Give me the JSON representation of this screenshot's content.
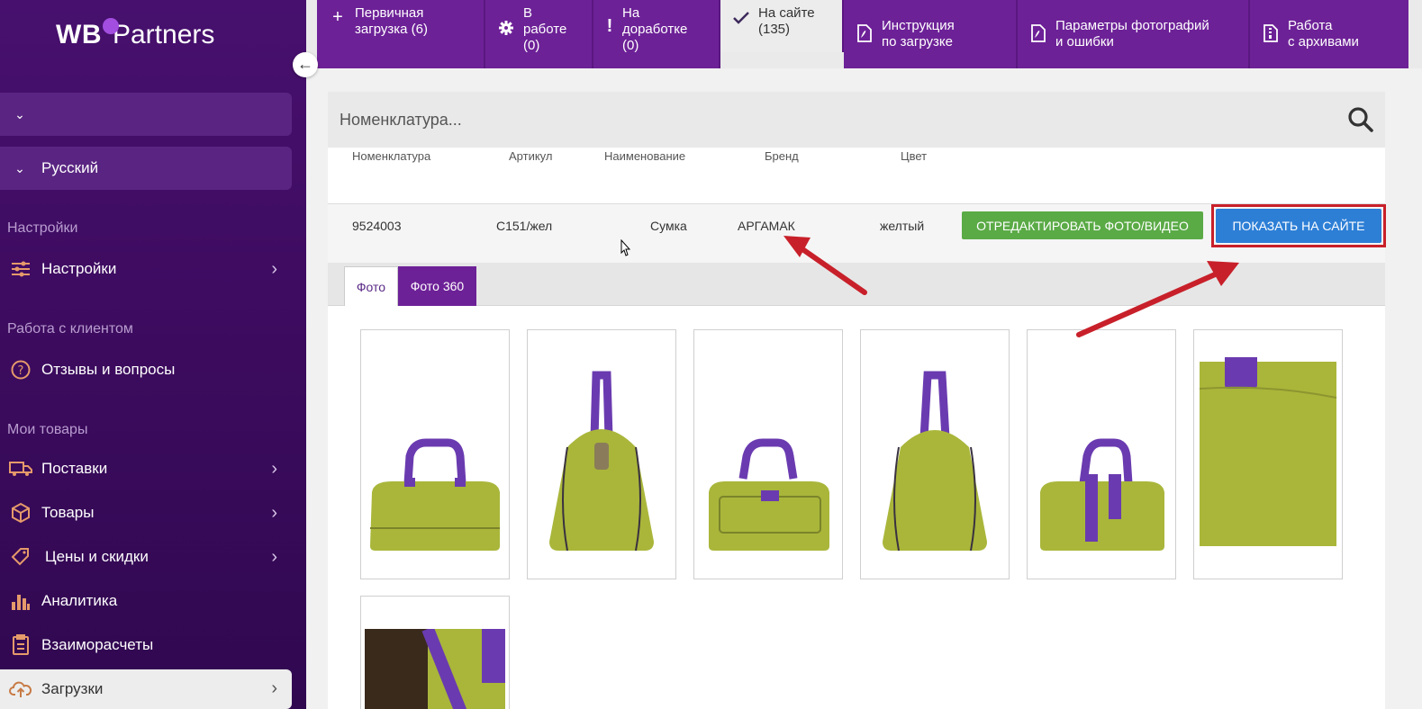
{
  "sidebar": {
    "logo_main": "WB",
    "logo_suffix": "Partners",
    "selector_top": {
      "label": ""
    },
    "language": {
      "label": "Русский"
    },
    "sections": [
      {
        "title": "Настройки"
      },
      {
        "title": "Работа с клиентом"
      },
      {
        "title": "Мои товары"
      }
    ],
    "items": [
      {
        "label": "Настройки",
        "icon": "sliders-icon"
      },
      {
        "label": "Отзывы и вопросы",
        "icon": "question-circle-icon"
      },
      {
        "label": "Поставки",
        "icon": "truck-icon"
      },
      {
        "label": "Товары",
        "icon": "box-icon"
      },
      {
        "label": "Цены и скидки",
        "icon": "tag-icon"
      },
      {
        "label": "Аналитика",
        "icon": "bar-chart-icon"
      },
      {
        "label": "Взаиморасчеты",
        "icon": "clipboard-icon"
      },
      {
        "label": "Загрузки",
        "icon": "cloud-upload-icon"
      }
    ]
  },
  "tabs": [
    {
      "line1": "Первичная",
      "line2": "загрузка (6)",
      "line3": "",
      "icon": "plus-icon"
    },
    {
      "line1": "В",
      "line2": "работе",
      "line3": "(0)",
      "icon": "gear-icon"
    },
    {
      "line1": "На",
      "line2": "доработке",
      "line3": "(0)",
      "icon": "exclamation-icon"
    },
    {
      "line1": "На сайте",
      "line2": "(135)",
      "line3": "",
      "icon": "check-icon"
    },
    {
      "line1": "Инструкция",
      "line2": "по загрузке",
      "line3": "",
      "icon": "pdf-icon"
    },
    {
      "line1": "Параметры фотографий",
      "line2": "и ошибки",
      "line3": "",
      "icon": "pdf-icon"
    },
    {
      "line1": "Работа",
      "line2": "с архивами",
      "line3": "",
      "icon": "archive-file-icon"
    }
  ],
  "search": {
    "placeholder": "Номенклатура..."
  },
  "table": {
    "headers": [
      "Номенклатура",
      "Артикул",
      "Наименование",
      "Бренд",
      "Цвет"
    ],
    "row": {
      "nomenclature": "9524003",
      "article": "C151/жел",
      "name": "Сумка",
      "brand": "АРГАМАК",
      "color": "желтый"
    },
    "edit_button": "ОТРЕДАКТИРОВАТЬ ФОТО/ВИДЕО",
    "show_button": "ПОКАЗАТЬ НА САЙТЕ"
  },
  "subtabs": [
    "Фото",
    "Фото 360"
  ],
  "colors": {
    "sidebar": "#3c0b5e",
    "tab_bg": "#6d2197",
    "green_button": "#5aaa46",
    "blue_button": "#2d7fd6",
    "highlight_border": "#c8202a",
    "bag": "#a9b63a",
    "strap": "#6a3bb0"
  }
}
